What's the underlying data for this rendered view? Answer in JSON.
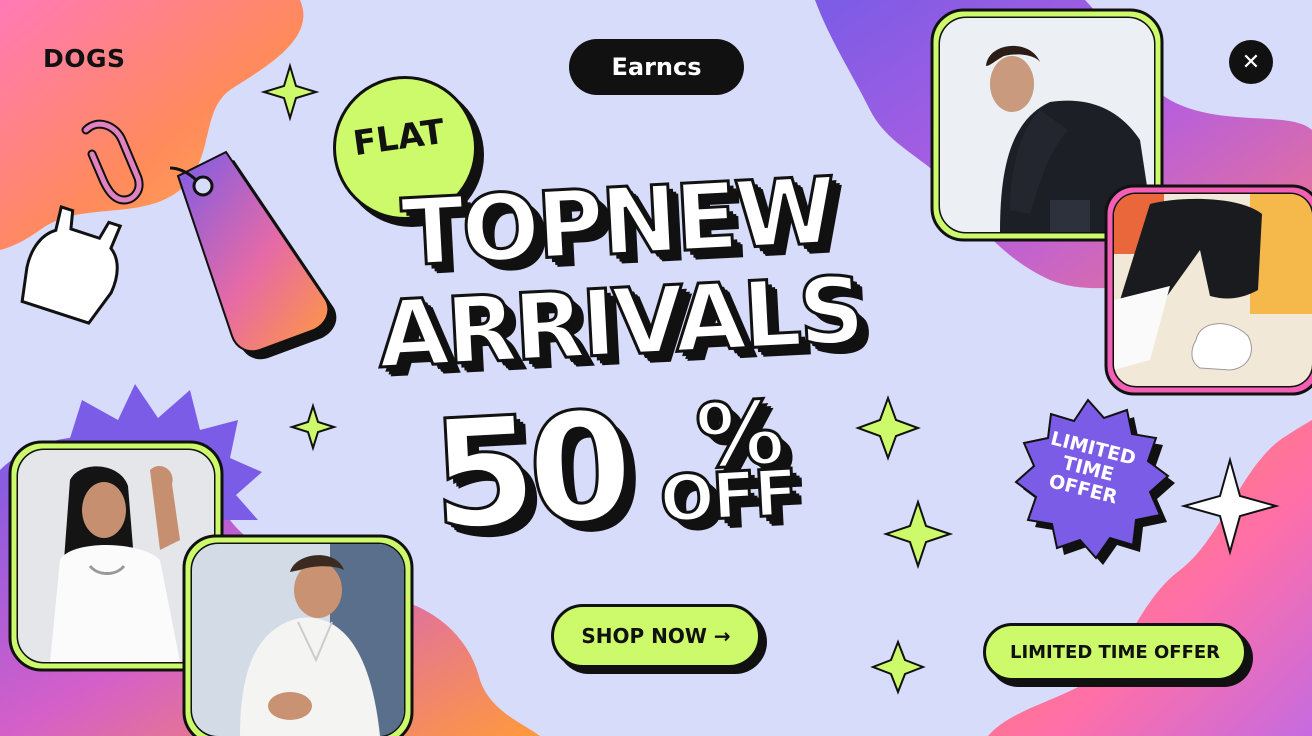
{
  "banner": {
    "brand_left": "DOGS",
    "brand_pill": "Earncs",
    "close_icon": "close-icon",
    "badge_flat": "FLAT",
    "headline": {
      "line1": "TOPNEW",
      "line2": "ARRIVALS",
      "discount_number": "50",
      "discount_symbol": "%",
      "discount_suffix": "OFF"
    },
    "seal": {
      "line1": "LIMITED",
      "line2": "TIME",
      "line3": "OFFER"
    },
    "cta_shop": "SHOP NOW →",
    "cta_limited": "LIMITED TIME OFFER"
  },
  "colors": {
    "background": "#d8dcfb",
    "accent_lime": "#cdfa6a",
    "purple": "#7b5ce6",
    "orange": "#ff9a3c",
    "pink": "#f25fb5",
    "ink": "#111111"
  },
  "icons": [
    "paperclip-icon",
    "price-tag-icon",
    "tank-top-icon",
    "sparkle-icon",
    "close-icon",
    "arrow-right-icon"
  ]
}
